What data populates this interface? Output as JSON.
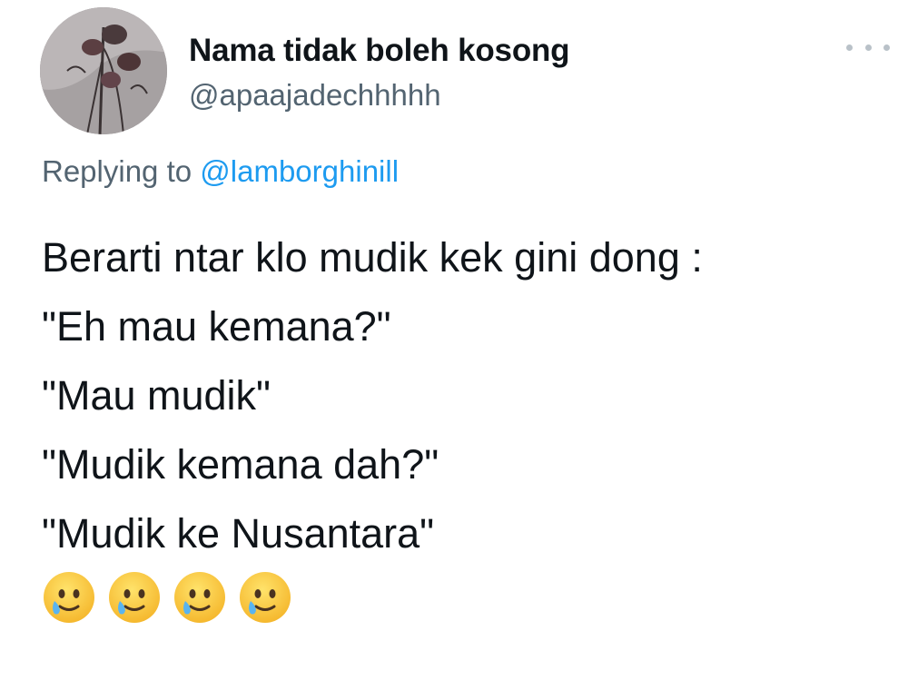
{
  "tweet": {
    "author": {
      "display_name": "Nama tidak boleh kosong",
      "handle": "@apaajadechhhhh",
      "avatar_icon": "avatar-dried-flowers"
    },
    "more_icon": "more-horizontal-icon",
    "replying_prefix": "Replying to",
    "replying_to": "@lamborghinill",
    "lines": [
      "Berarti ntar klo mudik kek gini dong :",
      "\"Eh mau kemana?\"",
      "\"Mau mudik\"",
      "\"Mudik kemana dah?\"",
      "\"Mudik ke Nusantara\""
    ],
    "emojis": [
      "smiling-face-with-tear",
      "smiling-face-with-tear",
      "smiling-face-with-tear",
      "smiling-face-with-tear"
    ]
  },
  "colors": {
    "text": "#0f1419",
    "secondary": "#536471",
    "link": "#1d9bf0"
  }
}
